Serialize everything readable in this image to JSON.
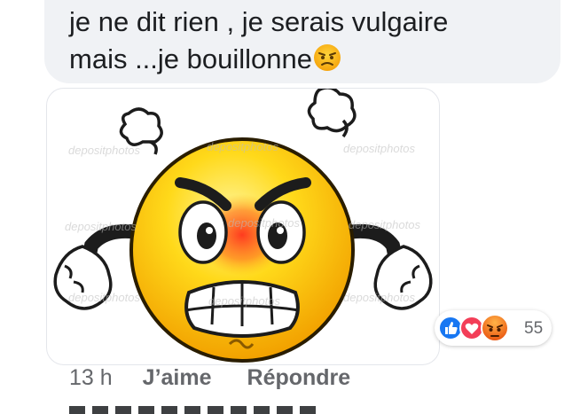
{
  "comment": {
    "text_line1": "je ne dit rien , je serais vulgaire",
    "text_line2": "mais ...je bouillonne",
    "emoji": "angry-emoji"
  },
  "attachment": {
    "watermark": "depositphotos",
    "subject": "angry-smiley-image"
  },
  "reactions": {
    "icons": [
      "like-icon",
      "love-icon",
      "angry-icon"
    ],
    "count": "55",
    "colors": {
      "like": "#1877f2",
      "love": "#f33e58",
      "angry": "#e9710f"
    }
  },
  "actions": {
    "time": "13 h",
    "like_label": "J’aime",
    "reply_label": "Répondre"
  }
}
